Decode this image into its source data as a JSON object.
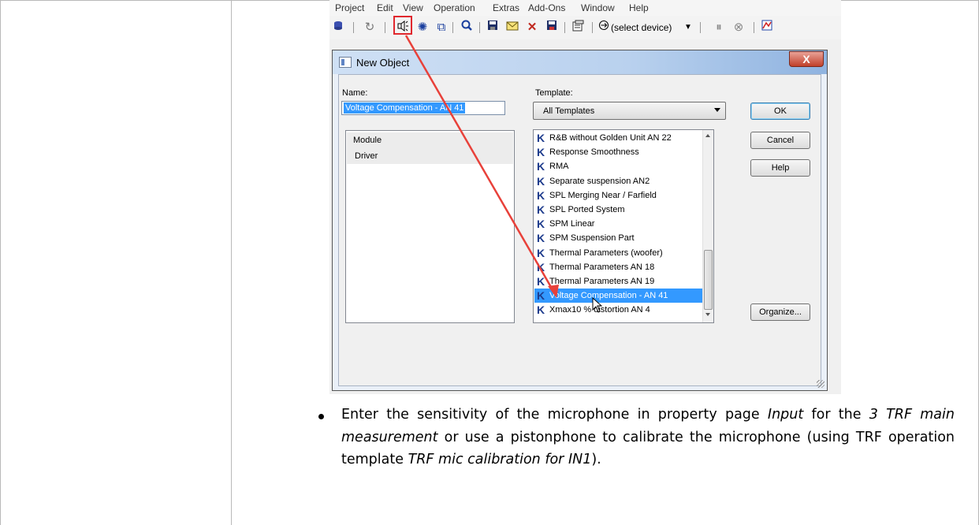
{
  "menu": [
    "Project",
    "Edit",
    "View",
    "Operation",
    "Extras",
    "Add-Ons",
    "Window",
    "Help"
  ],
  "toolbar": {
    "device_select": "(select device)"
  },
  "dialog": {
    "title": "New Object",
    "close_label": "X",
    "name_label": "Name:",
    "name_value": "Voltage Compensation - AN 41",
    "template_label": "Template:",
    "template_value": "All Templates",
    "module_rows": [
      "Module",
      "Driver"
    ],
    "template_icon_glyph": "K",
    "templates": [
      "R&B without Golden Unit AN 22",
      "Response Smoothness",
      "RMA",
      "Separate suspension AN2",
      "SPL Merging Near / Farfield",
      "SPL Ported System",
      "SPM Linear",
      "SPM Suspension Part",
      "Thermal Parameters (woofer)",
      "Thermal Parameters AN 18",
      "Thermal Parameters AN 19",
      "Voltage Compensation - AN 41",
      "Xmax10 % distortion AN 4"
    ],
    "selected_template": "Voltage Compensation - AN 41",
    "buttons": {
      "ok": "OK",
      "cancel": "Cancel",
      "help": "Help",
      "organize": "Organize..."
    }
  },
  "instruction": {
    "t1": "Enter the sensitivity of the microphone in property page ",
    "i1": "Input",
    "t2": " for the ",
    "i2": "3 TRF main measurement",
    "t3": " or use a pistonphone to calibrate the microphone (using TRF operation template ",
    "i3": "TRF mic calibration for IN1",
    "t4": ")."
  },
  "colors": {
    "highlight": "#e0282e",
    "selection": "#3399ff",
    "arrow": "#e8413a"
  }
}
